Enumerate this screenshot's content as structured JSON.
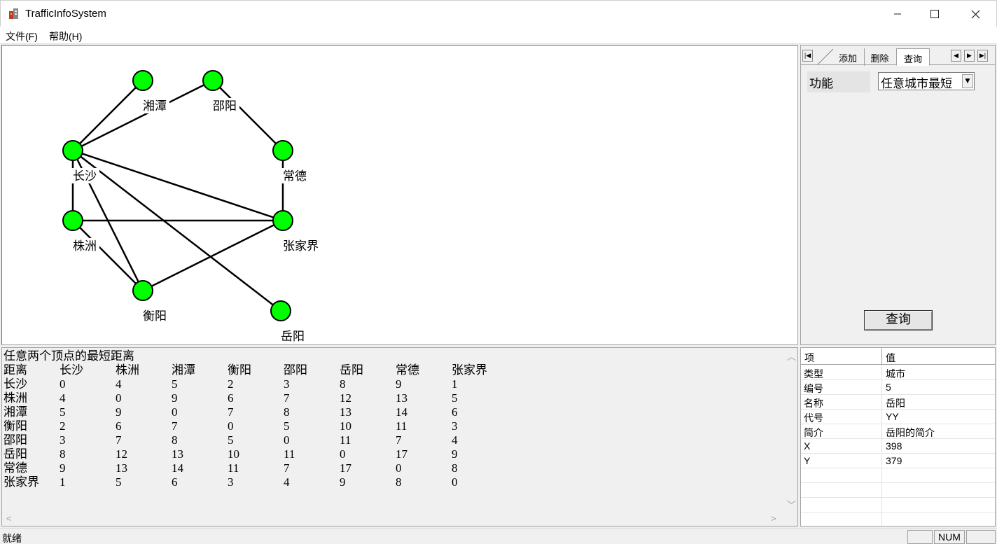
{
  "window": {
    "title": "TrafficInfoSystem"
  },
  "menu": [
    {
      "label": "文件(F)"
    },
    {
      "label": "帮助(H)"
    }
  ],
  "graph": {
    "nodes": [
      {
        "name": "湘潭"
      },
      {
        "name": "邵阳"
      },
      {
        "name": "长沙"
      },
      {
        "name": "常德"
      },
      {
        "name": "株洲"
      },
      {
        "name": "张家界"
      },
      {
        "name": "衡阳"
      },
      {
        "name": "岳阳"
      }
    ],
    "node_color": "#00ff00"
  },
  "tabs": [
    {
      "label": "添加"
    },
    {
      "label": "删除"
    },
    {
      "label": "查询",
      "active": true
    }
  ],
  "query_panel": {
    "function_label": "功能",
    "function_value": "任意城市最短",
    "query_button": "查询"
  },
  "result": {
    "title": "任意两个顶点的最短距离",
    "header": [
      "距离",
      "长沙",
      "株洲",
      "湘潭",
      "衡阳",
      "邵阳",
      "岳阳",
      "常德",
      "张家界"
    ],
    "rows": [
      [
        "长沙",
        "0",
        "4",
        "5",
        "2",
        "3",
        "8",
        "9",
        "1"
      ],
      [
        "株洲",
        "4",
        "0",
        "9",
        "6",
        "7",
        "12",
        "13",
        "5"
      ],
      [
        "湘潭",
        "5",
        "9",
        "0",
        "7",
        "8",
        "13",
        "14",
        "6"
      ],
      [
        "衡阳",
        "2",
        "6",
        "7",
        "0",
        "5",
        "10",
        "11",
        "3"
      ],
      [
        "邵阳",
        "3",
        "7",
        "8",
        "5",
        "0",
        "11",
        "7",
        "4"
      ],
      [
        "岳阳",
        "8",
        "12",
        "13",
        "10",
        "11",
        "0",
        "17",
        "9"
      ],
      [
        "常德",
        "9",
        "13",
        "14",
        "11",
        "7",
        "17",
        "0",
        "8"
      ],
      [
        "张家界",
        "1",
        "5",
        "6",
        "3",
        "4",
        "9",
        "8",
        "0"
      ]
    ]
  },
  "properties": {
    "header": {
      "key": "项",
      "value": "值"
    },
    "rows": [
      {
        "key": "类型",
        "value": "城市"
      },
      {
        "key": "编号",
        "value": "5"
      },
      {
        "key": "名称",
        "value": "岳阳"
      },
      {
        "key": "代号",
        "value": "YY"
      },
      {
        "key": "简介",
        "value": "岳阳的简介"
      },
      {
        "key": "X",
        "value": "398"
      },
      {
        "key": "Y",
        "value": "379"
      }
    ]
  },
  "status": {
    "text": "就绪",
    "num": "NUM"
  }
}
